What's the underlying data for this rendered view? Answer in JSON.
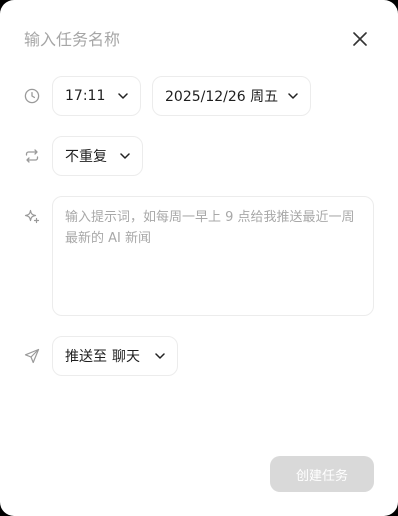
{
  "task_form": {
    "name_placeholder": "输入任务名称",
    "name_value": "",
    "time": "17:11",
    "date": "2025/12/26 周五",
    "repeat": "不重复",
    "prompt_placeholder": "输入提示词，如每周一早上 9 点给我推送最近一周最新的 AI 新闻",
    "prompt_value": "",
    "push_label": "推送至",
    "push_target": "聊天",
    "create_button": "创建任务"
  },
  "icons": {
    "close": "close-icon",
    "time": "clock-icon",
    "repeat": "repeat-icon",
    "prompt": "sparkle-icon",
    "push": "send-icon",
    "dropdown": "chevron-down-icon"
  },
  "colors": {
    "dialog_bg": "#ffffff",
    "border": "#ececec",
    "placeholder": "#a6a6a6",
    "icon_gray": "#9a9a9a",
    "button_disabled_bg": "#d9d9d9",
    "button_text": "#ffffff"
  }
}
